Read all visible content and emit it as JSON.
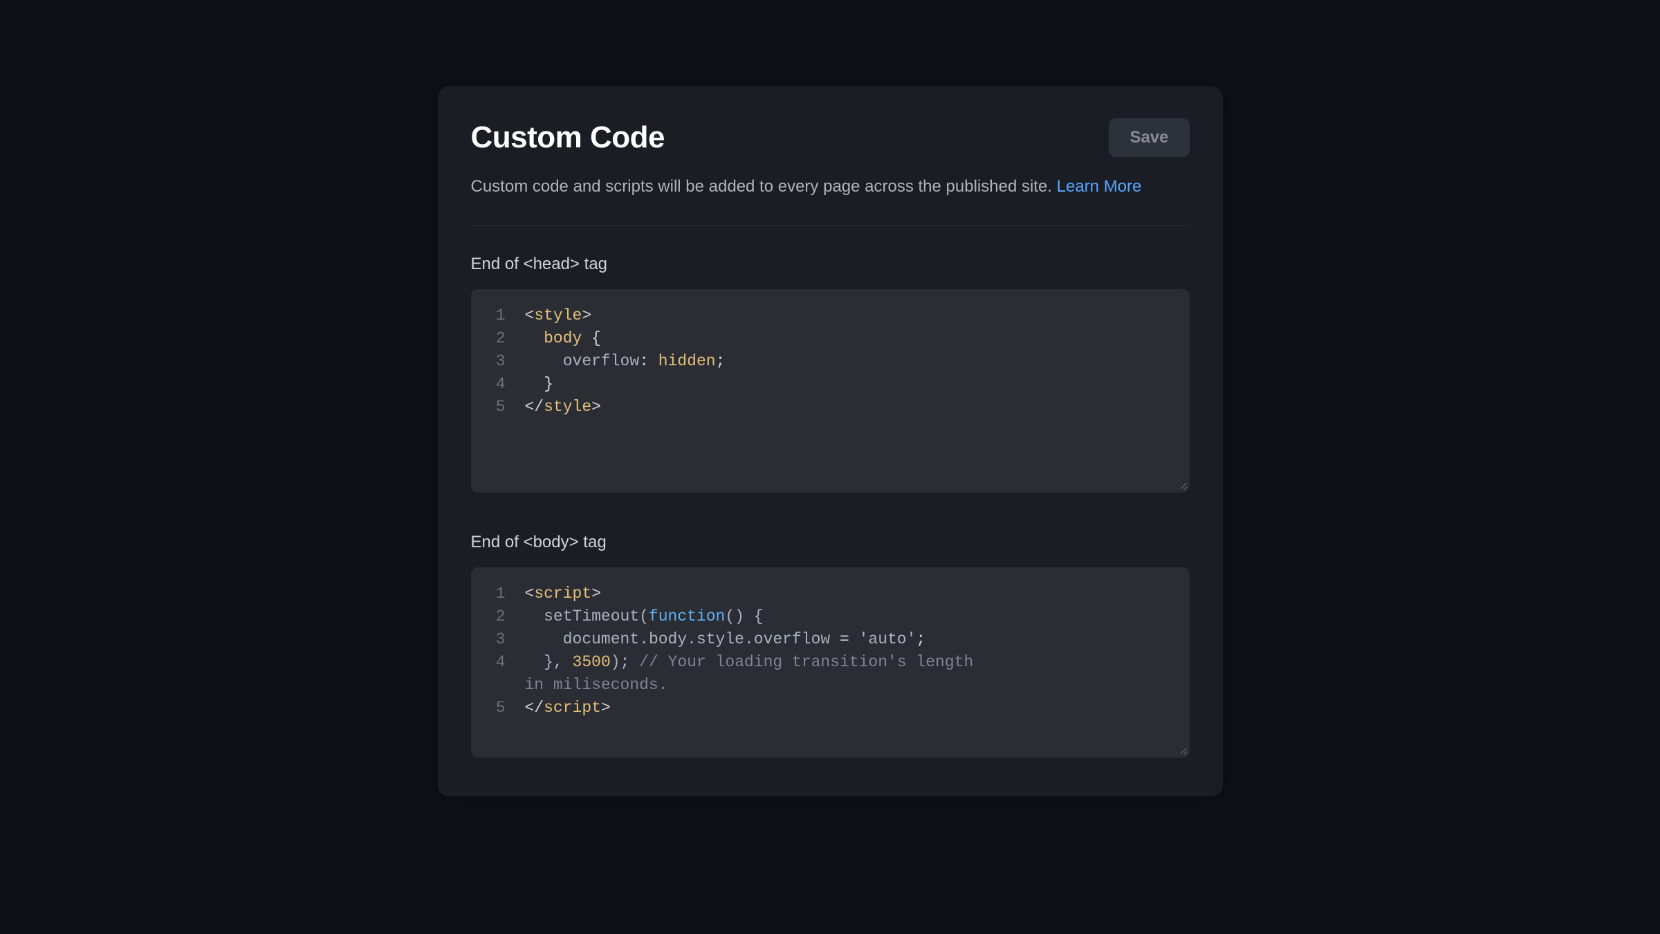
{
  "header": {
    "title": "Custom Code",
    "save_label": "Save"
  },
  "description": {
    "text": "Custom code and scripts will be added to every page across the published site. ",
    "learn_more_label": "Learn More"
  },
  "head_section": {
    "label": "End of <head> tag",
    "lines": [
      {
        "n": "1",
        "tokens": [
          {
            "t": "<",
            "c": "tok-punc"
          },
          {
            "t": "style",
            "c": "tok-tag"
          },
          {
            "t": ">",
            "c": "tok-punc"
          }
        ]
      },
      {
        "n": "2",
        "tokens": [
          {
            "t": "  ",
            "c": ""
          },
          {
            "t": "body",
            "c": "tok-selector"
          },
          {
            "t": " {",
            "c": "tok-punc"
          }
        ]
      },
      {
        "n": "3",
        "tokens": [
          {
            "t": "    ",
            "c": ""
          },
          {
            "t": "overflow",
            "c": "tok-prop"
          },
          {
            "t": ": ",
            "c": "tok-punc"
          },
          {
            "t": "hidden",
            "c": "tok-value"
          },
          {
            "t": ";",
            "c": "tok-punc"
          }
        ]
      },
      {
        "n": "4",
        "tokens": [
          {
            "t": "  }",
            "c": "tok-punc"
          }
        ]
      },
      {
        "n": "5",
        "tokens": [
          {
            "t": "</",
            "c": "tok-punc"
          },
          {
            "t": "style",
            "c": "tok-tag"
          },
          {
            "t": ">",
            "c": "tok-punc"
          }
        ]
      }
    ]
  },
  "body_section": {
    "label": "End of <body> tag",
    "lines": [
      {
        "n": "1",
        "tokens": [
          {
            "t": "<",
            "c": "tok-punc"
          },
          {
            "t": "script",
            "c": "tok-tag"
          },
          {
            "t": ">",
            "c": "tok-punc"
          }
        ]
      },
      {
        "n": "2",
        "tokens": [
          {
            "t": "  setTimeout(",
            "c": "tok-ident"
          },
          {
            "t": "function",
            "c": "tok-keyword"
          },
          {
            "t": "() {",
            "c": "tok-ident"
          }
        ]
      },
      {
        "n": "3",
        "tokens": [
          {
            "t": "    document.body.style.overflow ",
            "c": "tok-ident"
          },
          {
            "t": "= ",
            "c": "tok-punc"
          },
          {
            "t": "'auto'",
            "c": "tok-ident"
          },
          {
            "t": ";",
            "c": "tok-punc"
          }
        ]
      },
      {
        "n": "4",
        "tokens": [
          {
            "t": "  }, ",
            "c": "tok-ident"
          },
          {
            "t": "3500",
            "c": "tok-number"
          },
          {
            "t": "); ",
            "c": "tok-ident"
          },
          {
            "t": "// Your loading transition's length ",
            "c": "tok-comment"
          }
        ],
        "wrap_tokens": [
          {
            "t": "in miliseconds.",
            "c": "tok-comment"
          }
        ]
      },
      {
        "n": "5",
        "tokens": [
          {
            "t": "</",
            "c": "tok-punc"
          },
          {
            "t": "script",
            "c": "tok-tag"
          },
          {
            "t": ">",
            "c": "tok-punc"
          }
        ]
      }
    ]
  }
}
